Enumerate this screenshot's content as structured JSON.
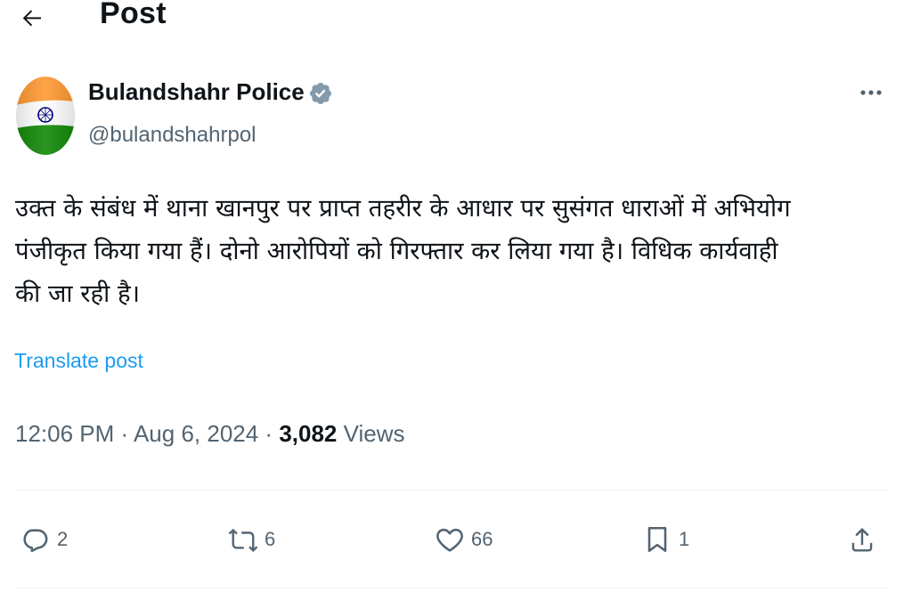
{
  "header": {
    "title": "Post"
  },
  "post": {
    "author": {
      "name": "Bulandshahr Police",
      "handle": "@bulandshahrpol",
      "verified": true
    },
    "text": "उक्त के संबंध में थाना खानपुर पर प्राप्त तहरीर के आधार पर सुसंगत धाराओं में अभियोग\nपंजीकृत किया गया हैं। दोनो आरोपियों को गिरफ्तार कर लिया गया है। विधिक कार्यवाही\nकी जा रही है।",
    "translate_label": "Translate post",
    "time": "12:06 PM",
    "date": "Aug 6, 2024",
    "separator": " · ",
    "views": "3,082",
    "views_label": " Views"
  },
  "actions": {
    "replies": "2",
    "reposts": "6",
    "likes": "66",
    "bookmarks": "1"
  },
  "icons": {
    "back": "arrow-left-icon",
    "more": "more-horizontal-icon",
    "verified": "verified-badge-icon",
    "reply": "reply-icon",
    "repost": "repost-icon",
    "like": "heart-icon",
    "bookmark": "bookmark-icon",
    "share": "share-icon"
  },
  "colors": {
    "text": "#0f1419",
    "secondary": "#536471",
    "link": "#1d9bf0",
    "verified": "#829aab",
    "divider": "#eff3f4",
    "flag_saffron": "#ff9933",
    "flag_green": "#138808",
    "chakra": "#000080"
  }
}
